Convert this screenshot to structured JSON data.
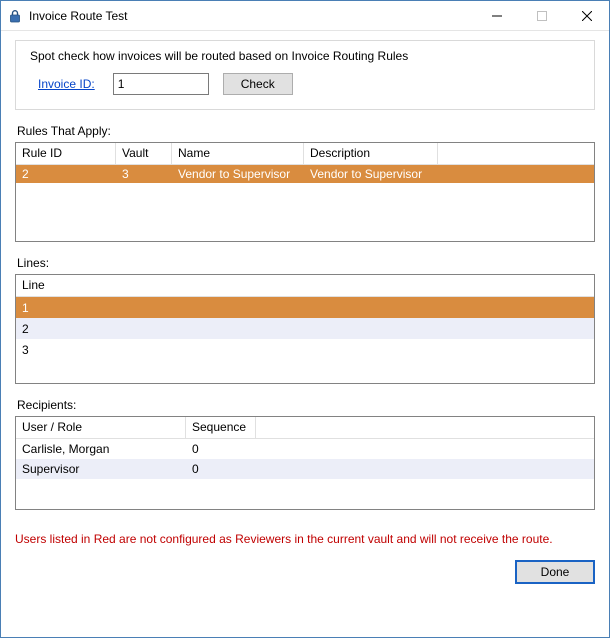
{
  "window": {
    "title": "Invoice Route Test"
  },
  "group": {
    "caption": "Spot check how invoices will be routed based on Invoice Routing Rules",
    "invoice_id_label": "Invoice ID:",
    "invoice_id_value": "1",
    "check_label": "Check"
  },
  "rules": {
    "label": "Rules That Apply:",
    "headers": {
      "rule_id": "Rule ID",
      "vault": "Vault",
      "name": "Name",
      "description": "Description"
    },
    "rows": [
      {
        "rule_id": "2",
        "vault": "3",
        "name": "Vendor to Supervisor",
        "description": "Vendor to Supervisor",
        "selected": true
      }
    ]
  },
  "lines": {
    "label": "Lines:",
    "header": "Line",
    "rows": [
      {
        "line": "1",
        "selected": true
      },
      {
        "line": "2",
        "alt": true
      },
      {
        "line": "3"
      }
    ]
  },
  "recipients": {
    "label": "Recipients:",
    "headers": {
      "user": "User / Role",
      "sequence": "Sequence"
    },
    "rows": [
      {
        "user": "Carlisle, Morgan",
        "sequence": "0"
      },
      {
        "user": "Supervisor",
        "sequence": "0",
        "alt": true
      }
    ]
  },
  "footer_note": "Users listed in Red are not configured as Reviewers in the current vault and will not receive the route.",
  "done_label": "Done"
}
